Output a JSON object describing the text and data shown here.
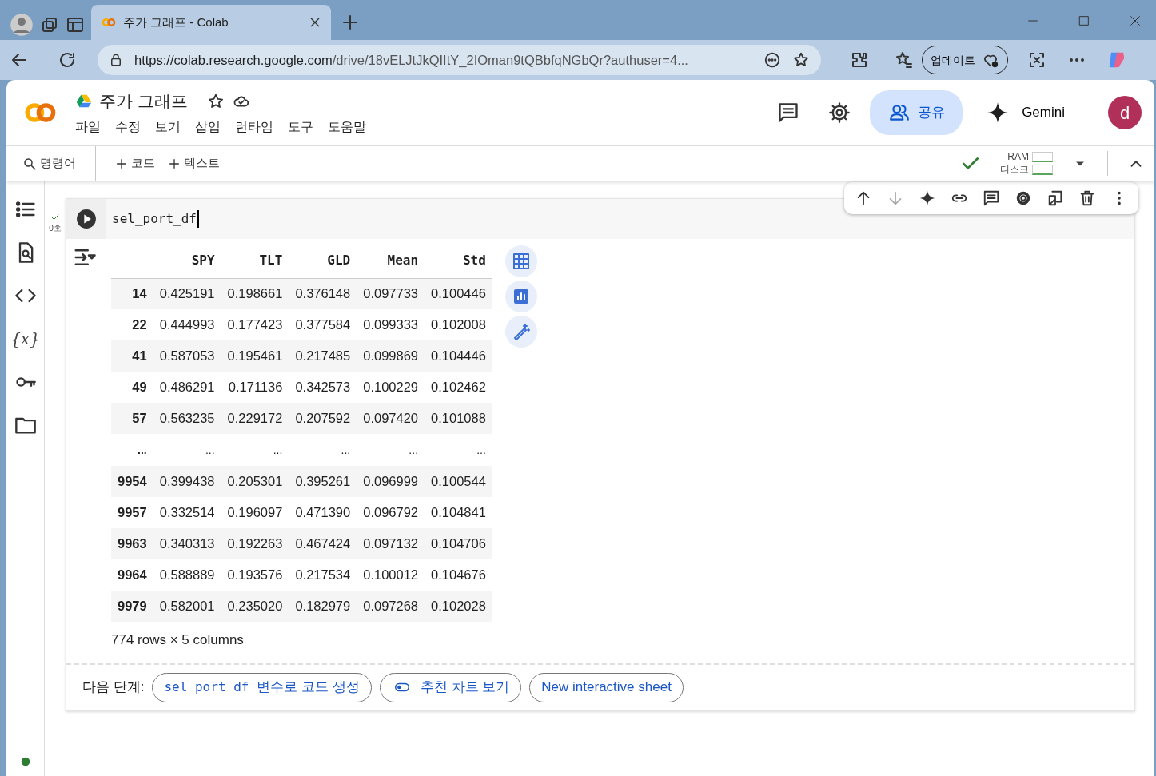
{
  "browser": {
    "tab_title": "주가 그래프 - Colab",
    "url_host": "https://colab.research.google.com",
    "url_path": "/drive/18vELJtJkQIItY_2IOman9tQBbfqNGbQr?authuser=4...",
    "update_label": "업데이트"
  },
  "notebook": {
    "title": "주가 그래프",
    "menu": [
      "파일",
      "수정",
      "보기",
      "삽입",
      "런타임",
      "도구",
      "도움말"
    ],
    "share_label": "공유",
    "gemini_label": "Gemini",
    "avatar_letter": "d"
  },
  "toolbar": {
    "command_label": "명령어",
    "add_code": "코드",
    "add_text": "텍스트",
    "connected": true,
    "ram_label": "RAM",
    "disk_label": "디스크"
  },
  "sidebar": {
    "items": [
      {
        "kind": "toc"
      },
      {
        "kind": "find"
      },
      {
        "kind": "snippets"
      },
      {
        "kind": "text",
        "label": "{x}"
      },
      {
        "kind": "secrets"
      },
      {
        "kind": "files"
      }
    ]
  },
  "cell": {
    "code": "sel_port_df",
    "executed": true,
    "exec_time": "0초"
  },
  "table": {
    "columns": [
      "",
      "SPY",
      "TLT",
      "GLD",
      "Mean",
      "Std"
    ],
    "rows": [
      {
        "kind": "data",
        "index": "14",
        "values": [
          "0.425191",
          "0.198661",
          "0.376148",
          "0.097733",
          "0.100446"
        ]
      },
      {
        "kind": "data",
        "index": "22",
        "values": [
          "0.444993",
          "0.177423",
          "0.377584",
          "0.099333",
          "0.102008"
        ]
      },
      {
        "kind": "data",
        "index": "41",
        "values": [
          "0.587053",
          "0.195461",
          "0.217485",
          "0.099869",
          "0.104446"
        ]
      },
      {
        "kind": "data",
        "index": "49",
        "values": [
          "0.486291",
          "0.171136",
          "0.342573",
          "0.100229",
          "0.102462"
        ]
      },
      {
        "kind": "data",
        "index": "57",
        "values": [
          "0.563235",
          "0.229172",
          "0.207592",
          "0.097420",
          "0.101088"
        ]
      },
      {
        "kind": "ellipsis",
        "index": "...",
        "values": [
          "...",
          "...",
          "...",
          "...",
          "..."
        ]
      },
      {
        "kind": "data",
        "index": "9954",
        "values": [
          "0.399438",
          "0.205301",
          "0.395261",
          "0.096999",
          "0.100544"
        ]
      },
      {
        "kind": "data",
        "index": "9957",
        "values": [
          "0.332514",
          "0.196097",
          "0.471390",
          "0.096792",
          "0.104841"
        ]
      },
      {
        "kind": "data",
        "index": "9963",
        "values": [
          "0.340313",
          "0.192263",
          "0.467424",
          "0.097132",
          "0.104706"
        ]
      },
      {
        "kind": "data",
        "index": "9964",
        "values": [
          "0.588889",
          "0.193576",
          "0.217534",
          "0.100012",
          "0.104676"
        ]
      },
      {
        "kind": "data",
        "index": "9979",
        "values": [
          "0.582001",
          "0.235020",
          "0.182979",
          "0.097268",
          "0.102028"
        ]
      }
    ],
    "shape": "774 rows × 5 columns"
  },
  "next_steps": {
    "label": "다음 단계:",
    "chips": [
      {
        "kind": "code",
        "code": "sel_port_df",
        "text": "변수로 코드 생성"
      },
      {
        "kind": "toggle",
        "text": "추천 차트 보기"
      },
      {
        "kind": "plain",
        "text": "New interactive sheet"
      }
    ]
  }
}
